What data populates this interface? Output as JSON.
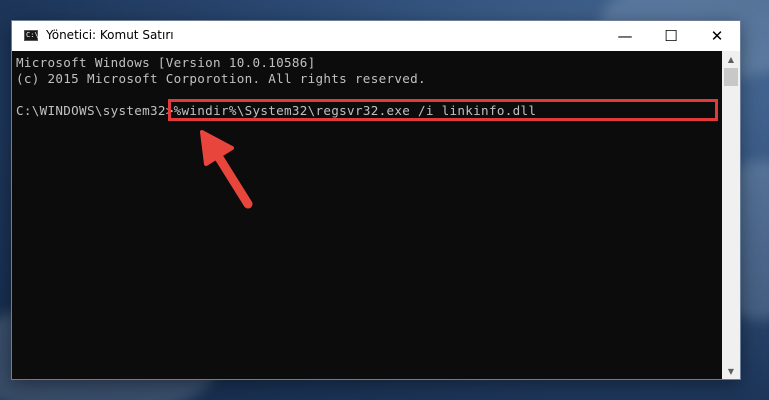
{
  "window": {
    "title": "Yönetici: Komut Satırı",
    "app_icon_label": "C:\\",
    "controls": {
      "minimize": "—",
      "maximize": "☐",
      "close": "✕"
    }
  },
  "console": {
    "lines": [
      "Microsoft Windows [Version 10.0.10586]",
      "(c) 2015 Microsoft Corporotion. All rights reserved."
    ],
    "prompt": "C:\\WINDOWS\\system32>",
    "command": "%windir%\\System32\\regsvr32.exe /i linkinfo.dll"
  },
  "scrollbar": {
    "up_arrow": "▲",
    "down_arrow": "▼"
  },
  "colors": {
    "console_background": "#0c0c0c",
    "console_text": "#c0c0c0",
    "highlight_border": "#e03a3a",
    "arrow": "#e8453c"
  },
  "icons": {
    "app": "cmd-icon",
    "annotation": "red-arrow-icon"
  }
}
